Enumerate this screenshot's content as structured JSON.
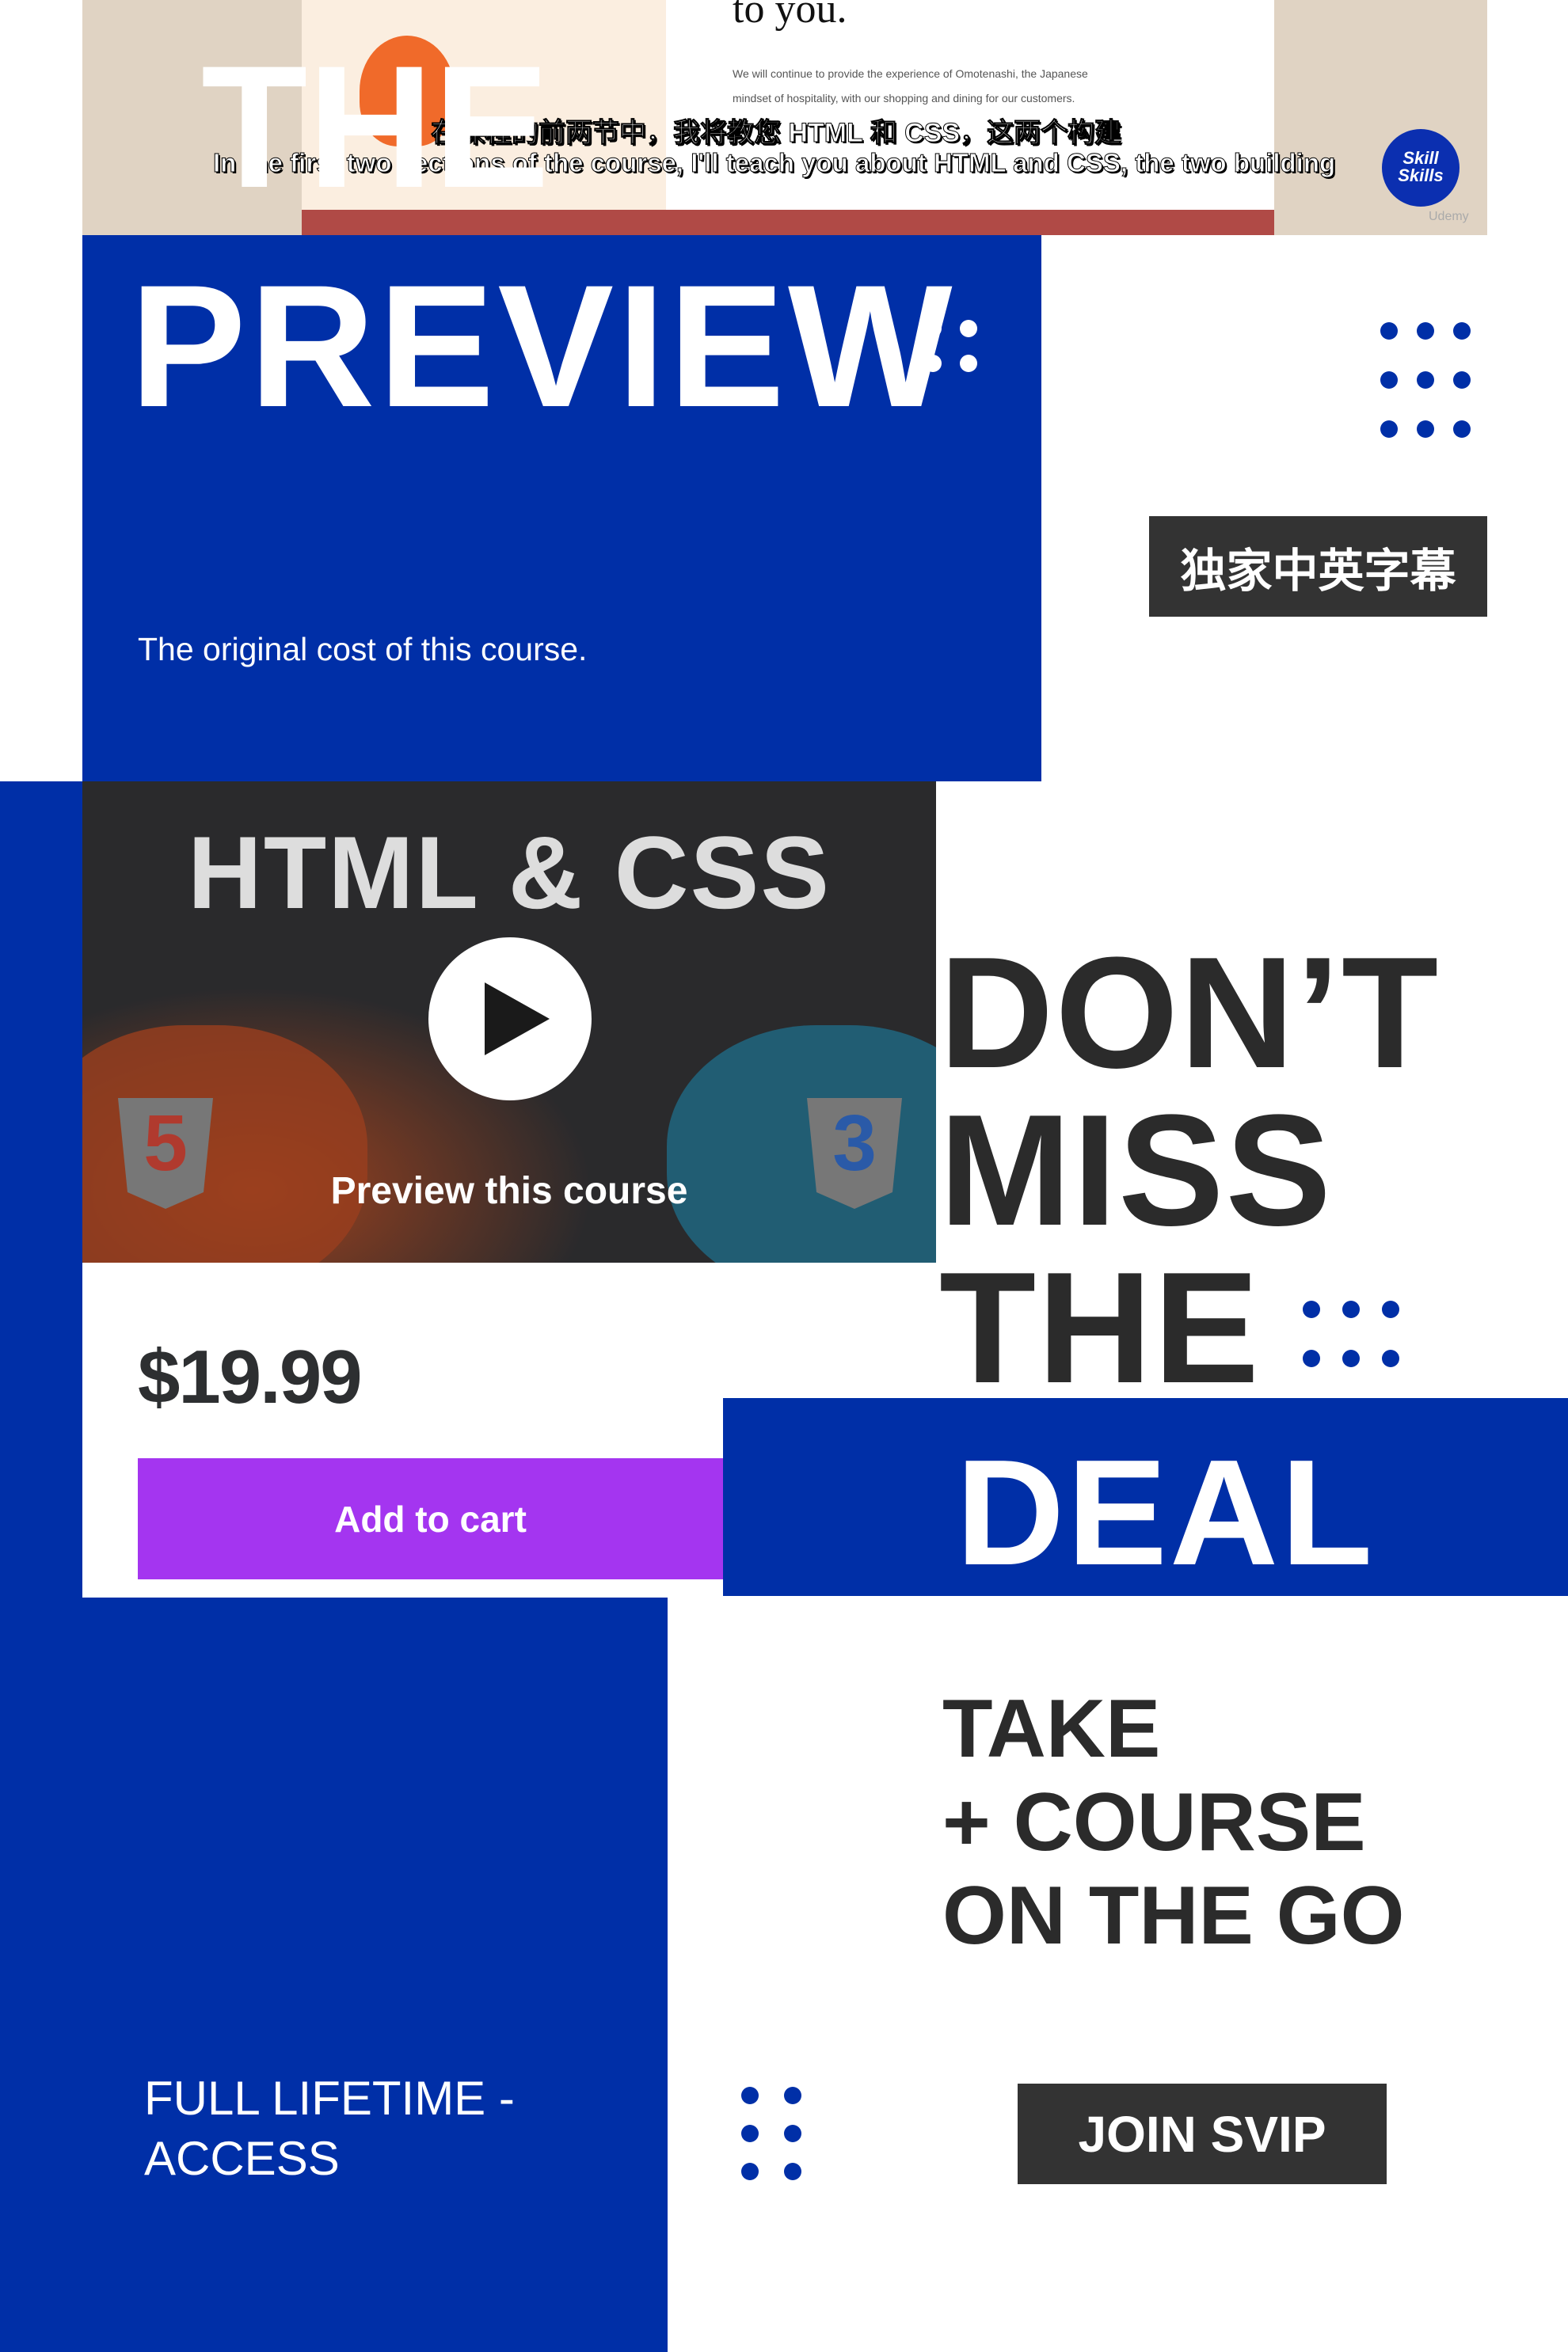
{
  "hero": {
    "heading": "to you.",
    "body_line1": "We will continue to provide the experience of Omotenashi, the Japanese",
    "body_line2": "mindset of hospitality, with our shopping and dining for our customers.",
    "subtitle_zh": "在课程的前两节中，我将教您 HTML 和 CSS，这两个构建",
    "subtitle_en": "In the first two sections of the course, I'll teach you about HTML and CSS, the two building",
    "logo_text": "Skill Skills",
    "watermark": "Udemy",
    "overlay_word": "THE"
  },
  "preview": {
    "title": "PREVIEW",
    "caption": "The original cost of this course."
  },
  "badge": "独家中英字幕",
  "video": {
    "title": "HTML & CSS",
    "preview_label": "Preview this course"
  },
  "card": {
    "price": "$19.99",
    "add_to_cart": "Add to cart"
  },
  "deal": {
    "line1": "DON’T",
    "line2": "MISS",
    "line3": "THE",
    "line4": "DEAL"
  },
  "promo": {
    "line1": "TAKE",
    "line2": "+ COURSE",
    "line3": "ON THE GO",
    "join_button": "JOIN SVIP"
  },
  "lifetime": {
    "line1": "FULL LIFETIME  -",
    "line2": "ACCESS"
  },
  "colors": {
    "brand_blue": "#002fa7",
    "cart_purple": "#a435f0",
    "dark": "#333333"
  }
}
